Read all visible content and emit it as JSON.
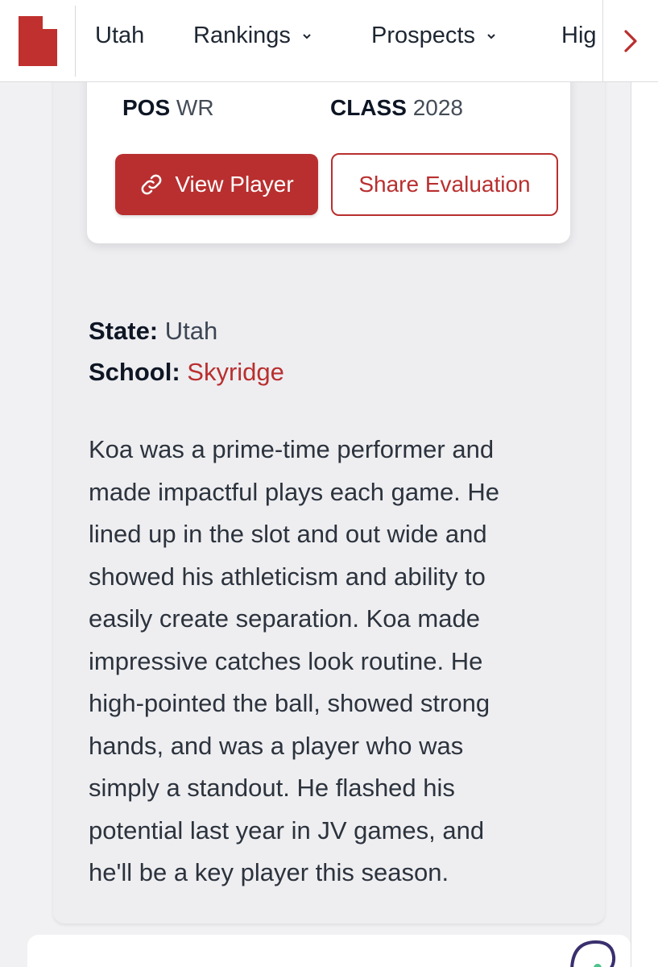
{
  "nav": {
    "items": [
      {
        "label": "Utah",
        "has_dropdown": false
      },
      {
        "label": "Rankings",
        "has_dropdown": true
      },
      {
        "label": "Prospects",
        "has_dropdown": true
      },
      {
        "label": "Hig",
        "has_dropdown": false
      }
    ],
    "logo_icon": "utah-state-icon",
    "scroll_icon": "chevron-right-icon"
  },
  "player": {
    "pos_label": "POS",
    "pos_value": "WR",
    "class_label": "CLASS",
    "class_value": "2028",
    "view_button": "View Player",
    "share_button": "Share Evaluation"
  },
  "details": {
    "state_label": "State:",
    "state_value": "Utah",
    "school_label": "School:",
    "school_value": "Skyridge"
  },
  "evaluation_lines": [
    "Koa was a prime-time performer and",
    "made impactful plays each game. He",
    "lined up in the slot and out wide and",
    "showed his athleticism and ability to",
    "easily create separation. Koa made",
    "impressive catches look routine. He",
    "high-pointed the ball, showed strong",
    "hands, and was a player who was",
    "simply a standout. He flashed his",
    "potential last year in JV games, and",
    "he'll be a key player this season."
  ],
  "colors": {
    "accent": "#b92f2f",
    "text": "#1e2632",
    "card_bg": "#eeeef1"
  }
}
